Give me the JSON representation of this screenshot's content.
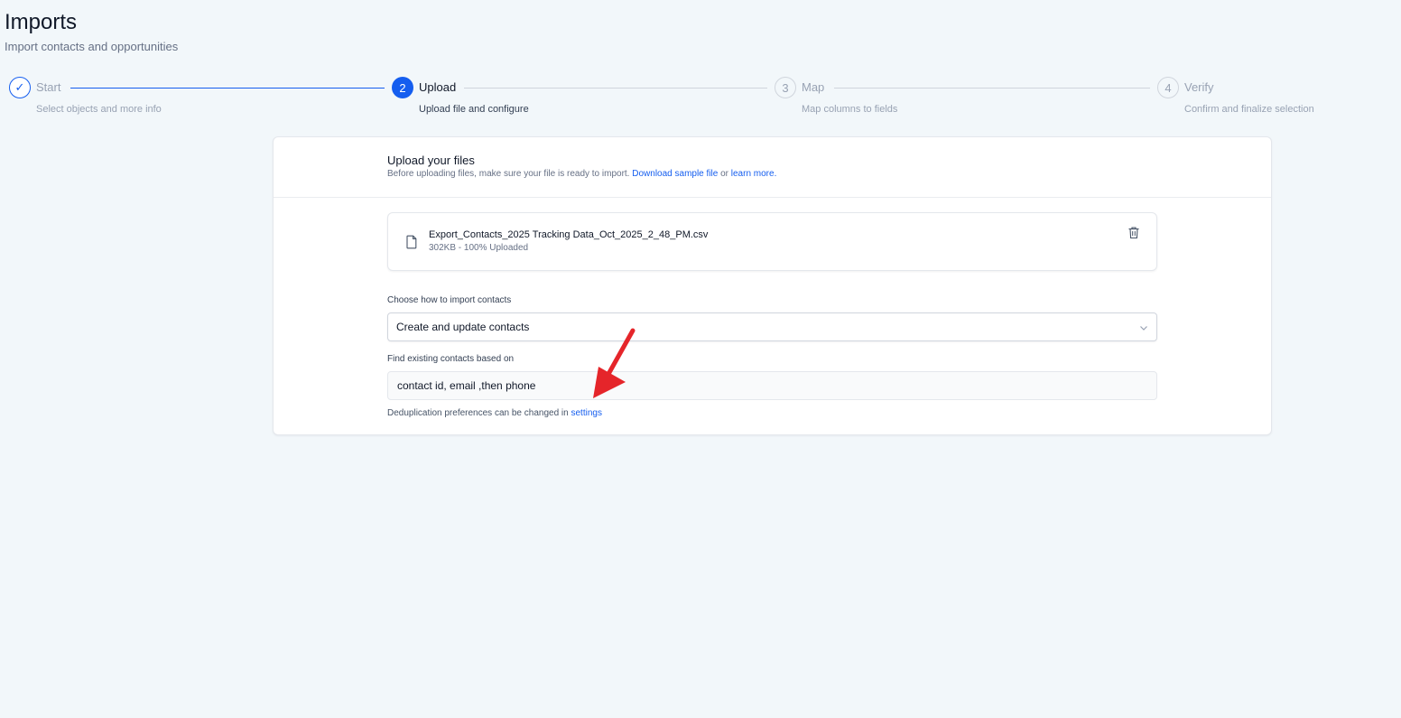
{
  "header": {
    "title": "Imports",
    "subtitle": "Import contacts and opportunities"
  },
  "stepper": {
    "steps": [
      {
        "number": "1",
        "label": "Start",
        "description": "Select objects and more info",
        "state": "done"
      },
      {
        "number": "2",
        "label": "Upload",
        "description": "Upload file and configure",
        "state": "active"
      },
      {
        "number": "3",
        "label": "Map",
        "description": "Map columns to fields",
        "state": "todo"
      },
      {
        "number": "4",
        "label": "Verify",
        "description": "Confirm and finalize selection",
        "state": "todo"
      }
    ],
    "check_glyph": "✓"
  },
  "card": {
    "title": "Upload your files",
    "help_prefix": "Before uploading files, make sure your file is ready to import. ",
    "help_link_sample": "Download sample file",
    "help_or": " or ",
    "help_link_learn": "learn more.",
    "file": {
      "name": "Export_Contacts_2025 Tracking Data_Oct_2025_2_48_PM.csv",
      "meta": "302KB - 100% Uploaded",
      "icon": "file-icon",
      "delete_icon": "trash-icon"
    },
    "import_mode": {
      "label": "Choose how to import contacts",
      "value": "Create and update contacts"
    },
    "dedup": {
      "label": "Find existing contacts based on",
      "value": "contact id, email ,then phone",
      "note_prefix": "Deduplication preferences can be changed in ",
      "note_link": "settings"
    }
  },
  "colors": {
    "accent": "#155eef",
    "annotation_arrow": "#e5252a",
    "background": "#f2f7fa"
  }
}
